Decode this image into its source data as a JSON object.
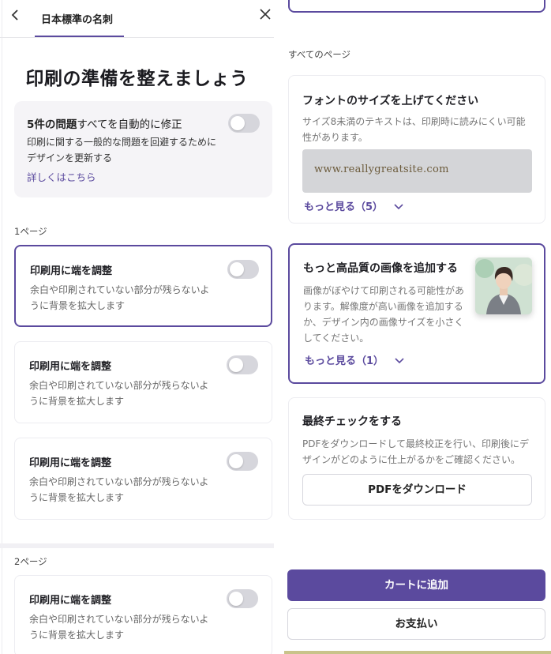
{
  "header": {
    "back_icon": "chevron-left-icon",
    "title": "日本標準の名刺",
    "close_icon": "close-icon"
  },
  "main": {
    "heading": "印刷の準備を整えましょう",
    "autofix": {
      "title_bold": "5件の問題",
      "title_rest": "すべてを自動的に修正",
      "description": "印刷に関する一般的な問題を回避するためにデザインを更新する",
      "link": "詳しくはこちら",
      "toggle_on": false
    },
    "page1_label": "1ページ",
    "page2_label": "2ページ",
    "issues": [
      {
        "title": "印刷用に端を調整",
        "description": "余白や印刷されていない部分が残らないように背景を拡大します",
        "toggle_on": false
      },
      {
        "title": "印刷用に端を調整",
        "description": "余白や印刷されていない部分が残らないように背景を拡大します",
        "toggle_on": false
      },
      {
        "title": "印刷用に端を調整",
        "description": "余白や印刷されていない部分が残らないように背景を拡大します",
        "toggle_on": false
      },
      {
        "title": "印刷用に端を調整",
        "description": "余白や印刷されていない部分が残らないように背景を拡大します",
        "toggle_on": false
      }
    ]
  },
  "right": {
    "all_pages_label": "すべてのページ",
    "font_card": {
      "title": "フォントのサイズを上げてください",
      "description": "サイズ8未満のテキストは、印刷時に読みにくい可能性があります。",
      "sample_text": "www.reallygreatsite.com",
      "more_label": "もっと見る（5）",
      "chevron_icon": "chevron-down-icon"
    },
    "image_card": {
      "title": "もっと高品質の画像を追加する",
      "description": "画像がぼやけて印刷される可能性があります。解像度が高い画像を追加するか、デザイン内の画像サイズを小さくしてください。",
      "more_label": "もっと見る（1）",
      "chevron_icon": "chevron-down-icon",
      "thumbnail": "portrait-photo"
    },
    "final_card": {
      "title": "最終チェックをする",
      "description": "PDFをダウンロードして最終校正を行い、印刷後にデザインがどのように仕上がるかをご確認ください。",
      "button_label": "PDFをダウンロード"
    },
    "cart_button": "カートに追加",
    "pay_button": "お支払い"
  },
  "colors": {
    "accent": "#5b4a9e",
    "toggle_off": "#d6d6dc",
    "muted_text": "#777777"
  }
}
